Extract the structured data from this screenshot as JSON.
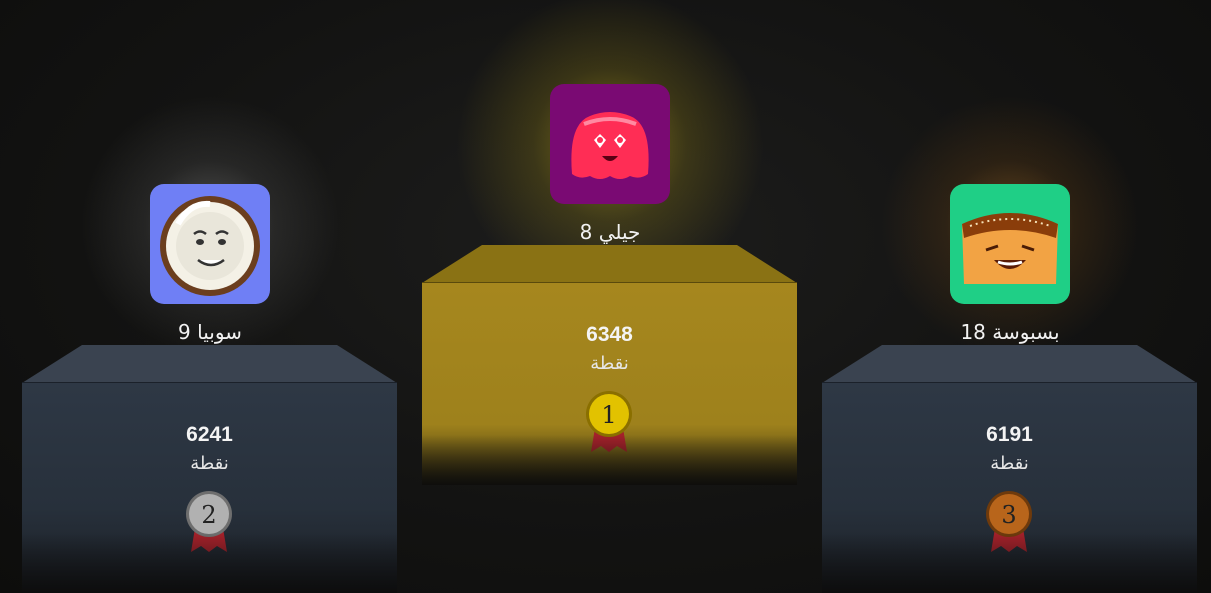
{
  "podium": {
    "first": {
      "name": "جيلي 8",
      "score": "6348",
      "unit": "نقطة",
      "rank": "1",
      "avatar_bg": "#7a0a73",
      "character": "jelly",
      "medal_color": "#d8b600"
    },
    "second": {
      "name": "سوبيا 9",
      "score": "6241",
      "unit": "نقطة",
      "rank": "2",
      "avatar_bg": "#6f7ff5",
      "character": "coconut",
      "medal_color": "#a7a7a7"
    },
    "third": {
      "name": "بسبوسة 18",
      "score": "6191",
      "unit": "نقطة",
      "rank": "3",
      "avatar_bg": "#1fcf86",
      "character": "basbousa",
      "medal_color": "#b8651b"
    }
  },
  "colors": {
    "gold_box": "#a6871e",
    "side_box": "#2b3441",
    "ribbon": "#a3212a"
  }
}
